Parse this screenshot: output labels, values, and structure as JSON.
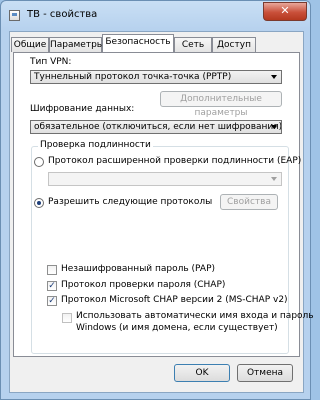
{
  "window": {
    "title": "ТВ - свойства",
    "close_label": "✕"
  },
  "tabs": [
    {
      "label": "Общие"
    },
    {
      "label": "Параметры"
    },
    {
      "label": "Безопасность"
    },
    {
      "label": "Сеть"
    },
    {
      "label": "Доступ"
    }
  ],
  "vpn": {
    "label": "Тип VPN:",
    "value": "Туннельный протокол точка-точка (PPTP)",
    "advanced_button": "Дополнительные параметры"
  },
  "encryption": {
    "label": "Шифрование данных:",
    "value": "обязательное (отключиться, если нет шифрования)"
  },
  "auth": {
    "group_title": "Проверка подлинности",
    "eap_label": "Протокол расширенной проверки подлинности (EAP)",
    "eap_value": "",
    "allow_label": "Разрешить следующие протоколы",
    "properties_button": "Свойства",
    "protocols": [
      {
        "label": "Незашифрованный пароль (PAP)",
        "checked": false
      },
      {
        "label": "Протокол проверки пароля (CHAP)",
        "checked": true
      },
      {
        "label": "Протокол Microsoft CHAP версии 2 (MS-CHAP v2)",
        "checked": true
      }
    ],
    "auto_login_label_1": "Использовать автоматически имя входа и пароль",
    "auto_login_label_2": "Windows (и имя домена, если существует)"
  },
  "buttons": {
    "ok": "OK",
    "cancel": "Отмена"
  },
  "colors": {
    "window_frame": "#b6d1ee",
    "close_button": "#c9503a",
    "radio_dot": "#1e3f7a"
  }
}
